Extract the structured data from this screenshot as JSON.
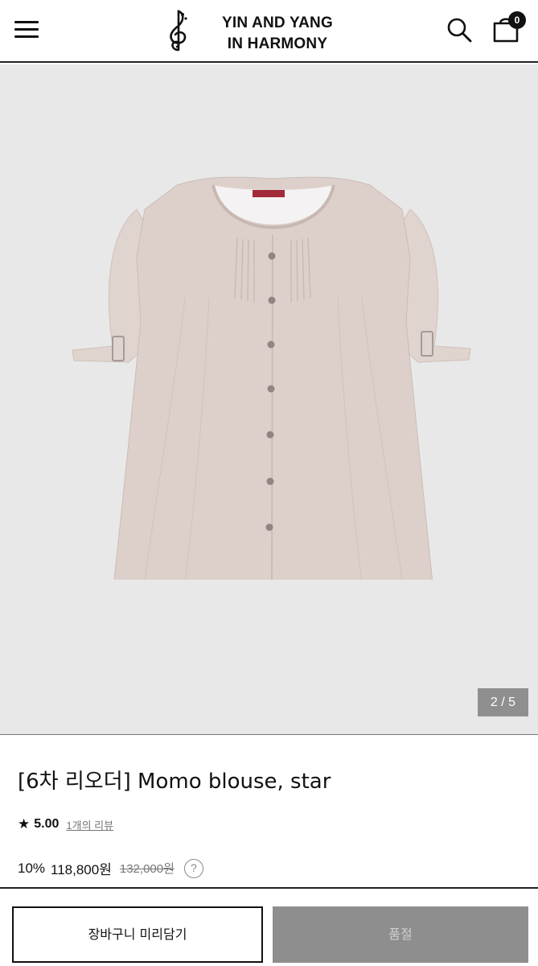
{
  "header": {
    "brand_line1": "YIN AND YANG",
    "brand_line2": "IN HARMONY",
    "cart_count": "0"
  },
  "gallery": {
    "counter": "2 / 5",
    "current_slide": 2,
    "total_slides": 5
  },
  "product": {
    "title": "[6차 리오더] Momo blouse, star",
    "rating_star": "★",
    "rating_score": "5.00",
    "review_link": "1개의 리뷰",
    "discount": "10%",
    "sale_price": "118,800원",
    "original_price": "132,000원",
    "help_icon": "?"
  },
  "actions": {
    "add_to_cart": "장바구니 미리담기",
    "sold_out": "품절"
  },
  "icons": [
    "hamburger-menu-icon",
    "treble-clef-logo-icon",
    "search-icon",
    "shopping-bag-icon",
    "help-circle-icon"
  ]
}
